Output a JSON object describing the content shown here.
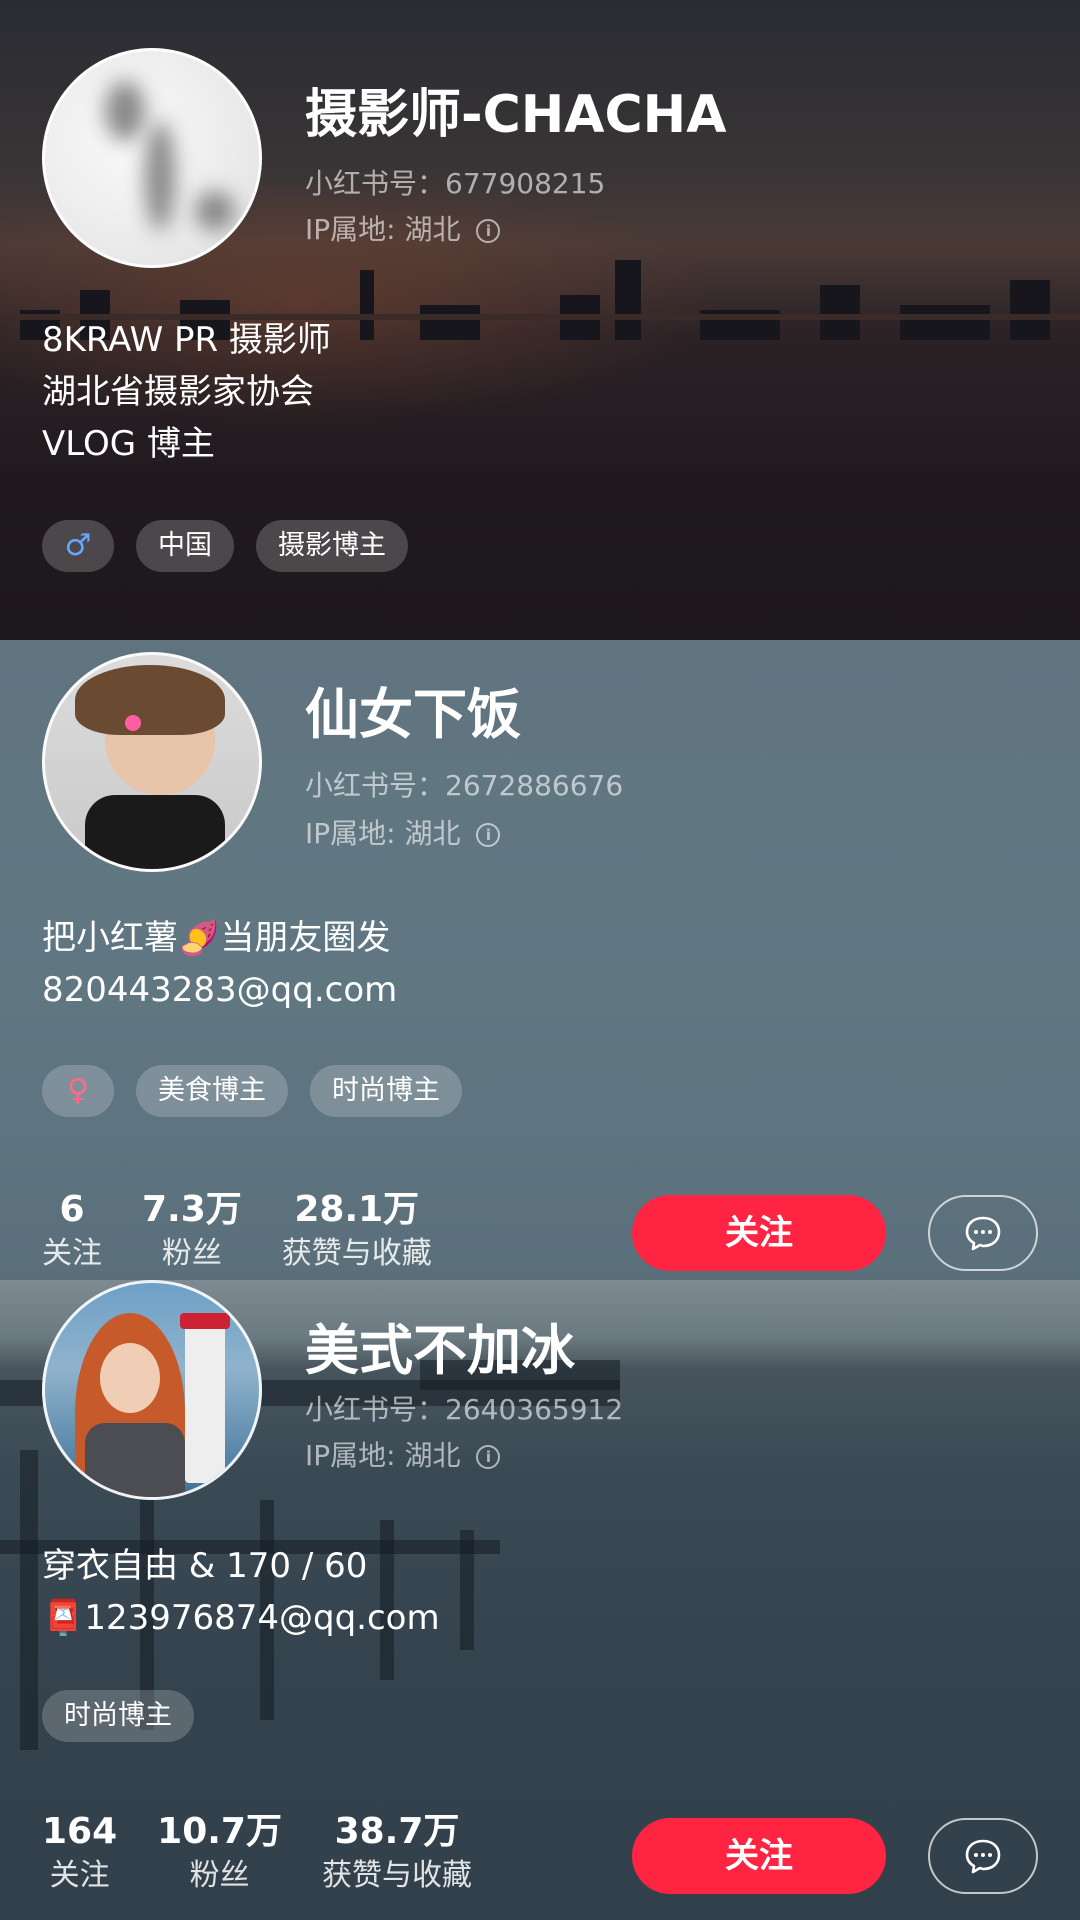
{
  "profiles": [
    {
      "name": "摄影师-CHACHA",
      "red_id": "小红书号：677908215",
      "ip": "IP属地: 湖北",
      "bio": [
        "8KRAW PR 摄影师",
        "湖北省摄影家协会",
        "VLOG 博主"
      ],
      "gender_icon": "♂",
      "tags": [
        "中国",
        "摄影博主"
      ]
    },
    {
      "name": "仙女下饭",
      "red_id": "小红书号：2672886676",
      "ip": "IP属地: 湖北",
      "bio": [
        "把小红薯🍠当朋友圈发",
        "820443283@qq.com"
      ],
      "gender_icon": "♀",
      "tags": [
        "美食博主",
        "时尚博主"
      ],
      "stats": [
        {
          "value": "6",
          "label": "关注"
        },
        {
          "value": "7.3万",
          "label": "粉丝"
        },
        {
          "value": "28.1万",
          "label": "获赞与收藏"
        }
      ],
      "follow_label": "关注"
    },
    {
      "name": "美式不加冰",
      "red_id": "小红书号：2640365912",
      "ip": "IP属地: 湖北",
      "bio": [
        "穿衣自由 & 170 / 60",
        "📮123976874@qq.com"
      ],
      "tags": [
        "时尚博主"
      ],
      "stats": [
        {
          "value": "164",
          "label": "关注"
        },
        {
          "value": "10.7万",
          "label": "粉丝"
        },
        {
          "value": "38.7万",
          "label": "获赞与收藏"
        }
      ],
      "follow_label": "关注"
    }
  ],
  "icons": {
    "info": "info-icon",
    "chat": "chat-bubble-icon"
  },
  "colors": {
    "follow_button": "#ff2442",
    "male": "#62a8ff",
    "female": "#ff6a8a"
  }
}
